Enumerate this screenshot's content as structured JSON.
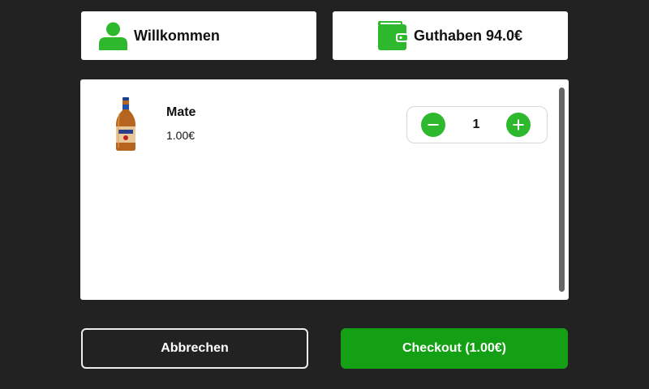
{
  "header": {
    "welcome_text": "Willkommen",
    "welcome_icon": "user-icon",
    "balance_text": "Guthaben 94.0€",
    "balance_icon": "wallet-icon"
  },
  "cart": {
    "items": [
      {
        "name": "Mate",
        "price": "1.00€",
        "quantity": "1",
        "image_icon": "bottle-icon"
      }
    ]
  },
  "actions": {
    "cancel_label": "Abbrechen",
    "checkout_label": "Checkout (1.00€)"
  },
  "colors": {
    "background": "#222222",
    "accent_green": "#2eb82e",
    "checkout_green": "#14a014",
    "card": "#ffffff"
  }
}
